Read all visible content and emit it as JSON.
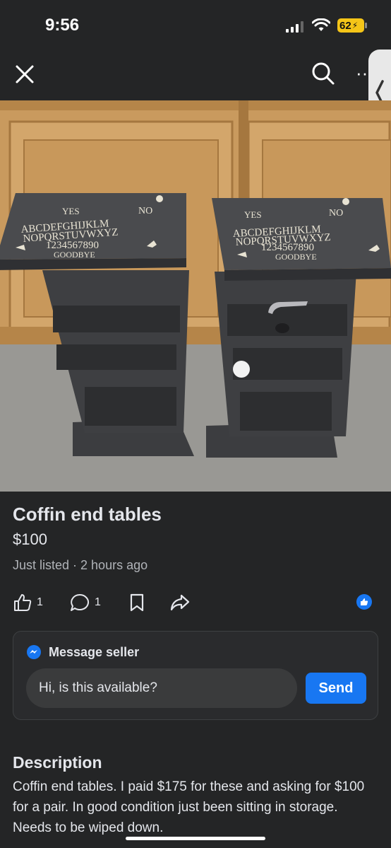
{
  "status_bar": {
    "time": "9:56",
    "battery": "62"
  },
  "nav": {
    "close_icon": "close-icon",
    "search_icon": "search-icon",
    "more_icon": "more-icon",
    "more_glyph": "··"
  },
  "listing": {
    "title": "Coffin end tables",
    "price": "$100",
    "meta": "Just listed · 2 hours ago",
    "photo_text": {
      "left_table": {
        "yes": "YES",
        "no": "NO",
        "alphabet_1": "ABCDEFGHIJKLM",
        "alphabet_2": "NOPQRSTUVWXYZ",
        "numbers": "1234567890",
        "goodbye": "GOODBYE"
      },
      "right_table": {
        "yes": "YES",
        "no": "NO",
        "alphabet_1": "ABCDEFGHIJKLM",
        "alphabet_2": "NOPQRSTUVWXYZ",
        "numbers": "1234567890",
        "goodbye": "GOODBYE"
      }
    }
  },
  "actions": {
    "like_count": "1",
    "comment_count": "1"
  },
  "message": {
    "header": "Message seller",
    "input_value": "Hi, is this available?",
    "send_label": "Send"
  },
  "description": {
    "title": "Description",
    "body": "Coffin end tables. I paid $175 for these and asking for $100 for a pair. In good condition just been sitting in storage. Needs to be wiped down."
  },
  "colors": {
    "background": "#242526",
    "accent": "#1877f2",
    "battery": "#f5c518"
  }
}
